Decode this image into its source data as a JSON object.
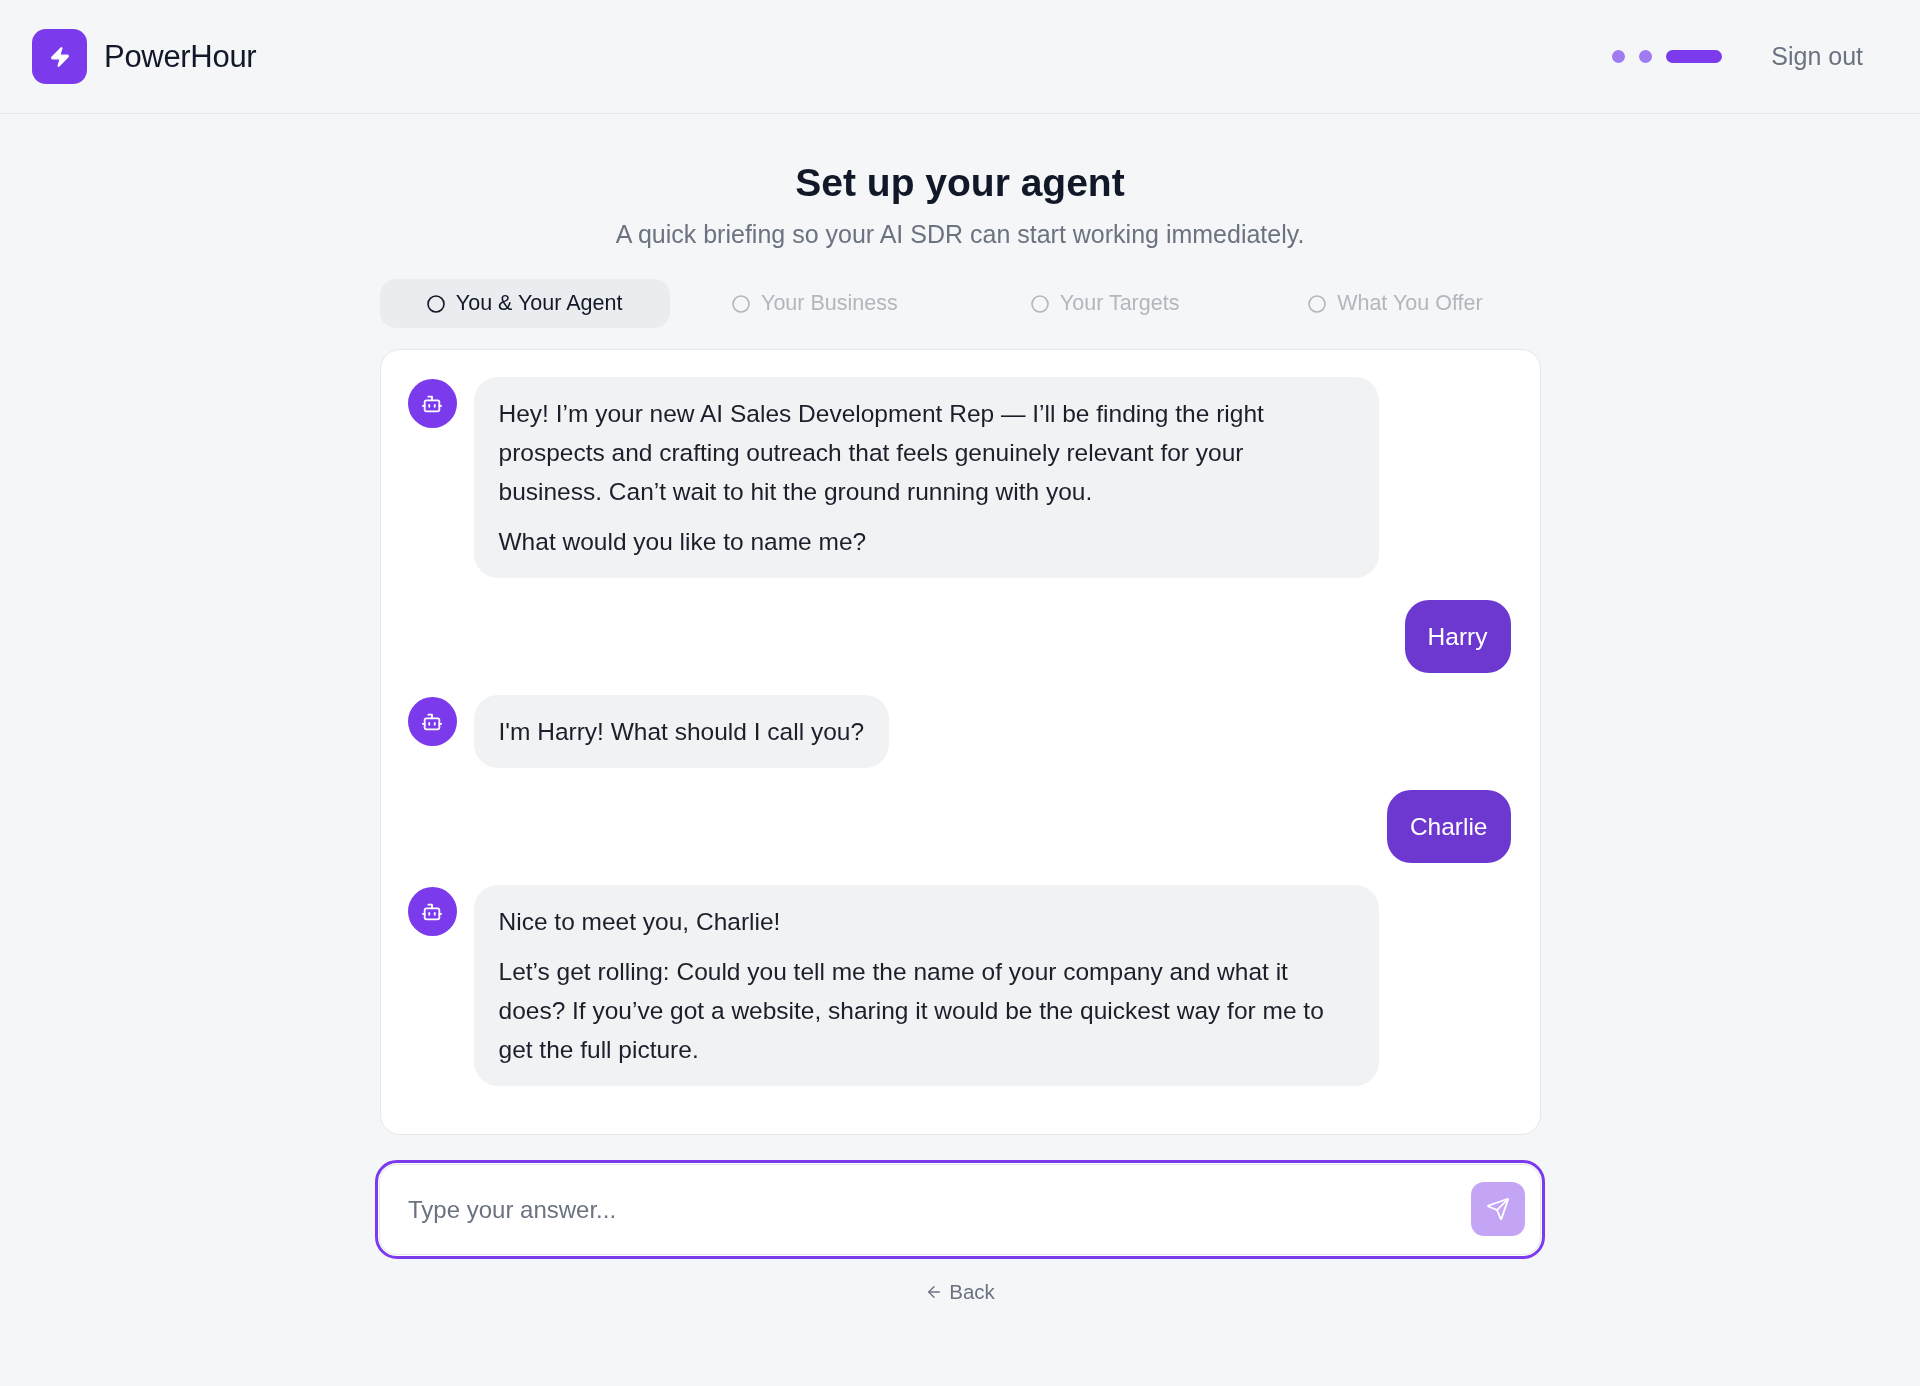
{
  "header": {
    "brand": "PowerHour",
    "progress_steps": [
      {
        "selected": false
      },
      {
        "selected": false
      },
      {
        "selected": true
      }
    ],
    "sign_out": "Sign out"
  },
  "title": "Set up your agent",
  "subtitle": "A quick briefing so your AI SDR can start working immediately.",
  "tabs": [
    {
      "label": "You & Your Agent",
      "selected": true
    },
    {
      "label": "Your Business",
      "selected": false
    },
    {
      "label": "Your Targets",
      "selected": false
    },
    {
      "label": "What You Offer",
      "selected": false
    }
  ],
  "messages": [
    {
      "kind": "bot",
      "paragraphs": [
        "Hey! I’m your new AI Sales Development Rep — I’ll be finding the right prospects and crafting outreach that feels genuinely relevant for your business. Can’t wait to hit the ground running with you.",
        "What would you like to name me?"
      ]
    },
    {
      "kind": "user",
      "paragraphs": [
        "Harry"
      ]
    },
    {
      "kind": "bot",
      "paragraphs": [
        "I'm Harry! What should I call you?"
      ]
    },
    {
      "kind": "user",
      "paragraphs": [
        "Charlie"
      ]
    },
    {
      "kind": "bot",
      "paragraphs": [
        "Nice to meet you, Charlie!",
        "Let’s get rolling: Could you tell me the name of your company and what it does? If you’ve got a website, sharing it would be the quickest way for me to get the full picture."
      ]
    }
  ],
  "composer": {
    "placeholder": "Type your answer...",
    "send_disabled": true
  },
  "back": {
    "label": "Back"
  }
}
